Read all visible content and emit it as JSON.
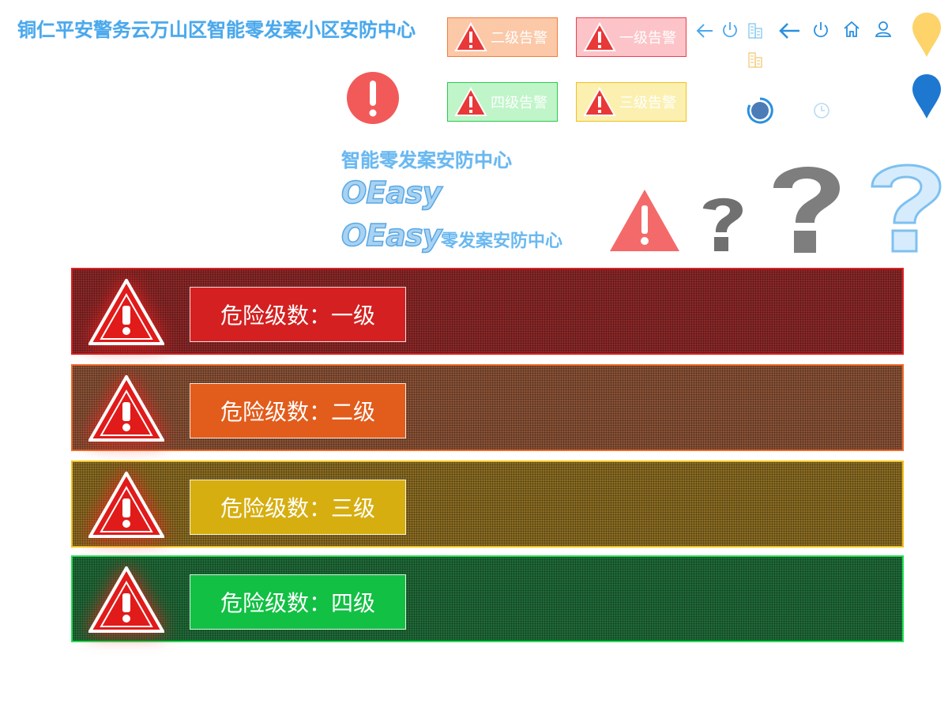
{
  "header": {
    "title": "铜仁平安警务云万山区智能零发案小区安防中心"
  },
  "alerts": [
    {
      "label": "二级告警"
    },
    {
      "label": "一级告警"
    },
    {
      "label": "四级告警"
    },
    {
      "label": "三级告警"
    }
  ],
  "toolbar": {
    "icons": [
      "arrow-left-icon",
      "power-icon",
      "building-icon",
      "arrow-left-icon",
      "power-icon",
      "home-icon",
      "user-icon",
      "building-icon",
      "spinner-icon",
      "clock-icon",
      "map-pin-icon"
    ]
  },
  "logos": {
    "subtitle": "智能零发案安防中心",
    "easy": "OEasy",
    "subtitle2": "零发案安防中心"
  },
  "panels": [
    {
      "label": "危险级数：一级",
      "color": "#e02020"
    },
    {
      "label": "危险级数：二级",
      "color": "#f06a28"
    },
    {
      "label": "危险级数：三级",
      "color": "#f0c018"
    },
    {
      "label": "危险级数：四级",
      "color": "#20e050"
    }
  ],
  "colors": {
    "accent": "#4aa8ec",
    "danger": "#f25a5a",
    "question_gray": "#808080"
  }
}
